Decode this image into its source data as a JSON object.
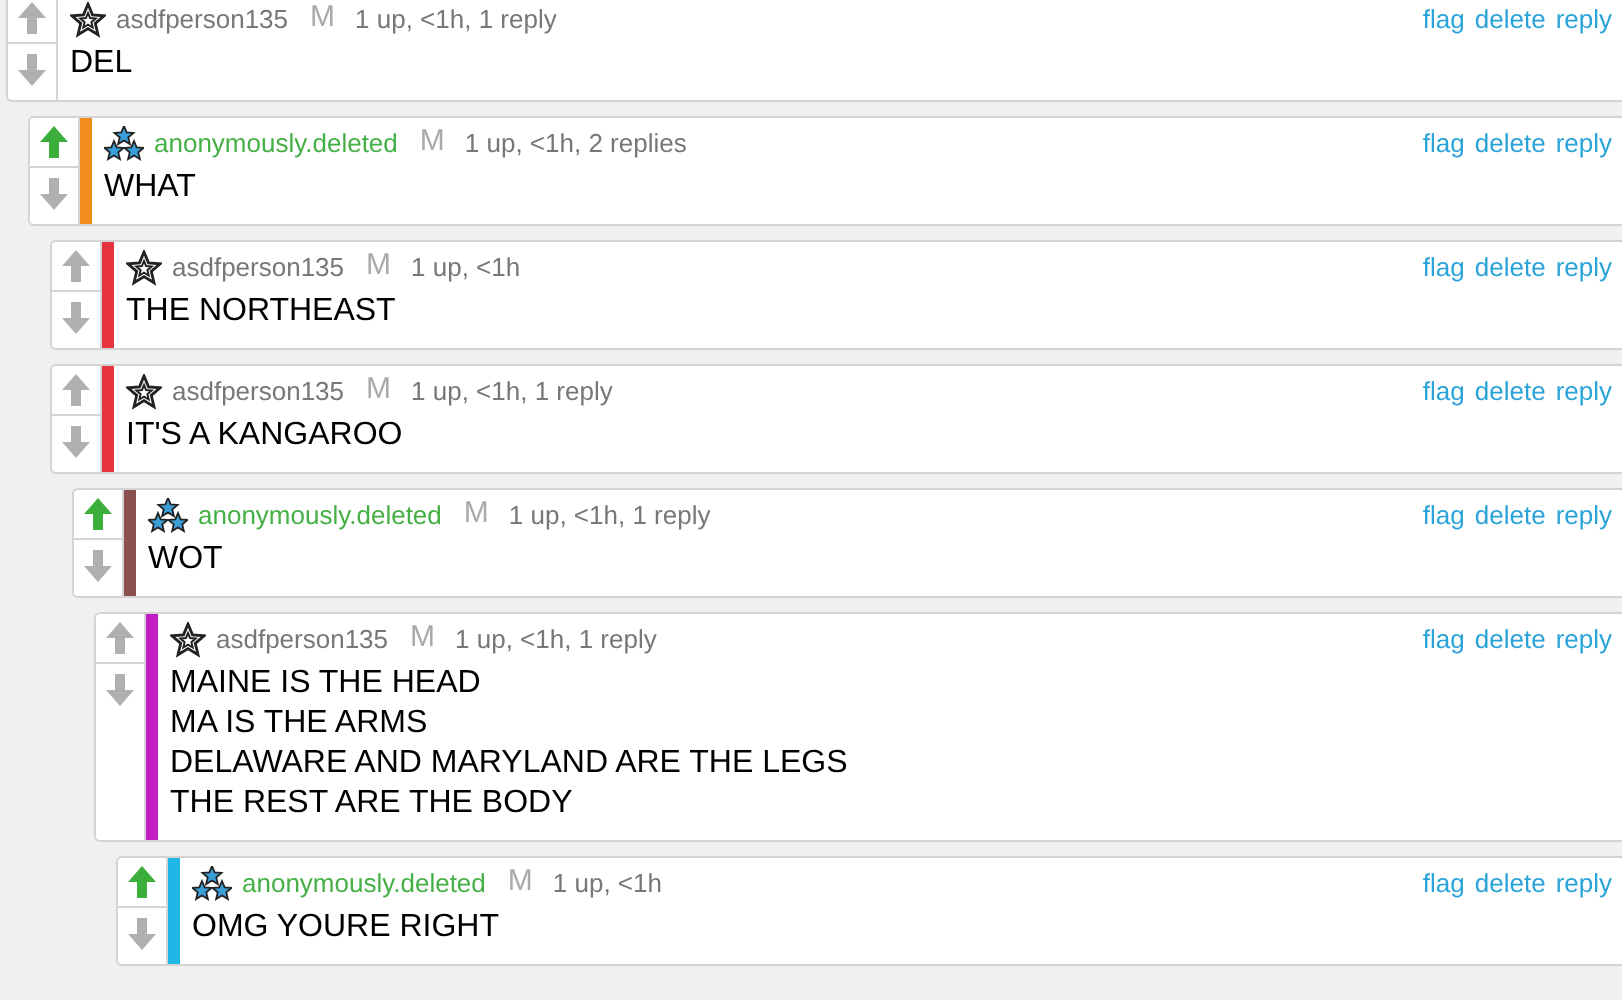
{
  "comments": [
    {
      "user": "asdfperson135",
      "kind": "single-star",
      "highlighted": false,
      "mod_mark": "M",
      "meta": "1 up, <1h, 1 reply",
      "body": [
        "DEL"
      ],
      "upvoted": false,
      "actions": [
        "flag",
        "delete",
        "reply"
      ],
      "children": [
        {
          "user": "anonymously.deleted",
          "kind": "triple-star",
          "highlighted": true,
          "mod_mark": "M",
          "meta": "1 up, <1h, 2 replies",
          "body": [
            "WHAT"
          ],
          "upvoted": true,
          "color": "#f28c1c",
          "actions": [
            "flag",
            "delete",
            "reply"
          ],
          "children": [
            {
              "user": "asdfperson135",
              "kind": "single-star",
              "highlighted": false,
              "mod_mark": "M",
              "meta": "1 up, <1h",
              "body": [
                "THE NORTHEAST"
              ],
              "upvoted": false,
              "color": "#e8343f",
              "actions": [
                "flag",
                "delete",
                "reply"
              ]
            },
            {
              "user": "asdfperson135",
              "kind": "single-star",
              "highlighted": false,
              "mod_mark": "M",
              "meta": "1 up, <1h, 1 reply",
              "body": [
                "IT'S A KANGAROO"
              ],
              "upvoted": false,
              "color": "#e8343f",
              "actions": [
                "flag",
                "delete",
                "reply"
              ],
              "children": [
                {
                  "user": "anonymously.deleted",
                  "kind": "triple-star",
                  "highlighted": true,
                  "mod_mark": "M",
                  "meta": "1 up, <1h, 1 reply",
                  "body": [
                    "WOT"
                  ],
                  "upvoted": true,
                  "color": "#8a5050",
                  "actions": [
                    "flag",
                    "delete",
                    "reply"
                  ],
                  "children": [
                    {
                      "user": "asdfperson135",
                      "kind": "single-star",
                      "highlighted": false,
                      "mod_mark": "M",
                      "meta": "1 up, <1h, 1 reply",
                      "body": [
                        "MAINE IS THE HEAD",
                        "MA IS THE ARMS",
                        "DELAWARE AND MARYLAND ARE THE LEGS",
                        "THE REST ARE THE BODY"
                      ],
                      "upvoted": false,
                      "color": "#c21dc2",
                      "actions": [
                        "flag",
                        "delete",
                        "reply"
                      ],
                      "children": [
                        {
                          "user": "anonymously.deleted",
                          "kind": "triple-star",
                          "highlighted": true,
                          "mod_mark": "M",
                          "meta": "1 up, <1h",
                          "body": [
                            "OMG YOURE RIGHT"
                          ],
                          "upvoted": true,
                          "color": "#1fb8e6",
                          "actions": [
                            "flag",
                            "delete",
                            "reply"
                          ]
                        }
                      ]
                    }
                  ]
                }
              ]
            }
          ]
        }
      ]
    }
  ]
}
